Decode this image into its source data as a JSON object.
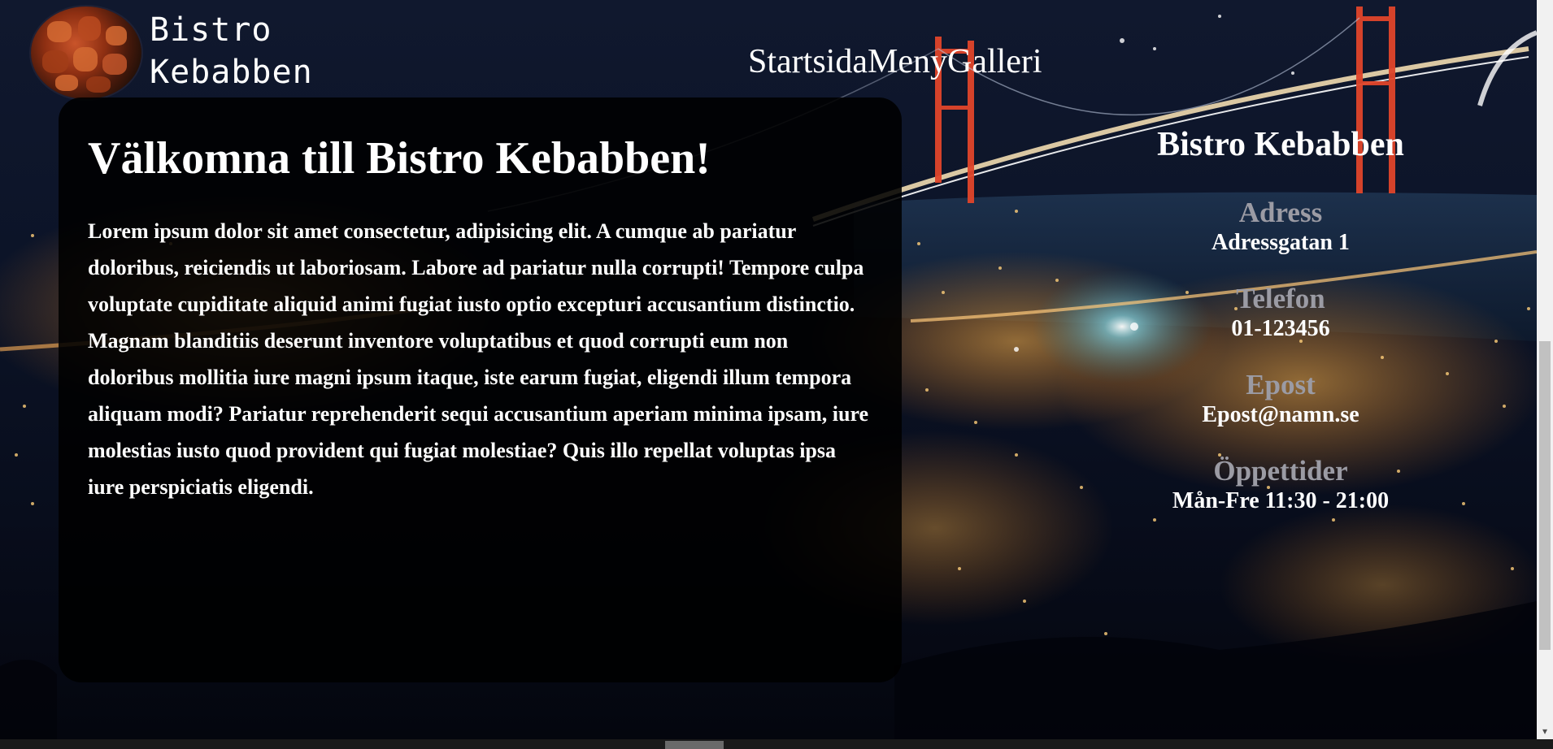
{
  "brand": {
    "logo_line1": "Bistro",
    "logo_line2": "Kebabben"
  },
  "nav": {
    "items": [
      "Startsida",
      "Meny",
      "Galleri"
    ]
  },
  "welcome": {
    "heading": "Välkomna till Bistro Kebabben!",
    "body": "Lorem ipsum dolor sit amet consectetur, adipisicing elit. A cumque ab pariatur doloribus, reiciendis ut laboriosam. Labore ad pariatur nulla corrupti! Tempore culpa voluptate cupiditate aliquid animi fugiat iusto optio excepturi accusantium distinctio. Magnam blanditiis deserunt inventore voluptatibus et quod corrupti eum non doloribus mollitia iure magni ipsum itaque, iste earum fugiat, eligendi illum tempora aliquam modi? Pariatur reprehenderit sequi accusantium aperiam minima ipsam, iure molestias iusto quod provident qui fugiat molestiae? Quis illo repellat voluptas ipsa iure perspiciatis eligendi."
  },
  "contact": {
    "title": "Bistro Kebabben",
    "address_label": "Adress",
    "address_value": "Adressgatan 1",
    "phone_label": "Telefon",
    "phone_value": "01-123456",
    "email_label": "Epost",
    "email_value": "Epost@namn.se",
    "hours_label": "Öppettider",
    "hours_value": "Mån-Fre 11:30 - 21:00"
  },
  "colors": {
    "card_background": "#000000",
    "label_gray": "#9b9ba4",
    "text": "#ffffff",
    "bridge_red": "#e0452a"
  }
}
